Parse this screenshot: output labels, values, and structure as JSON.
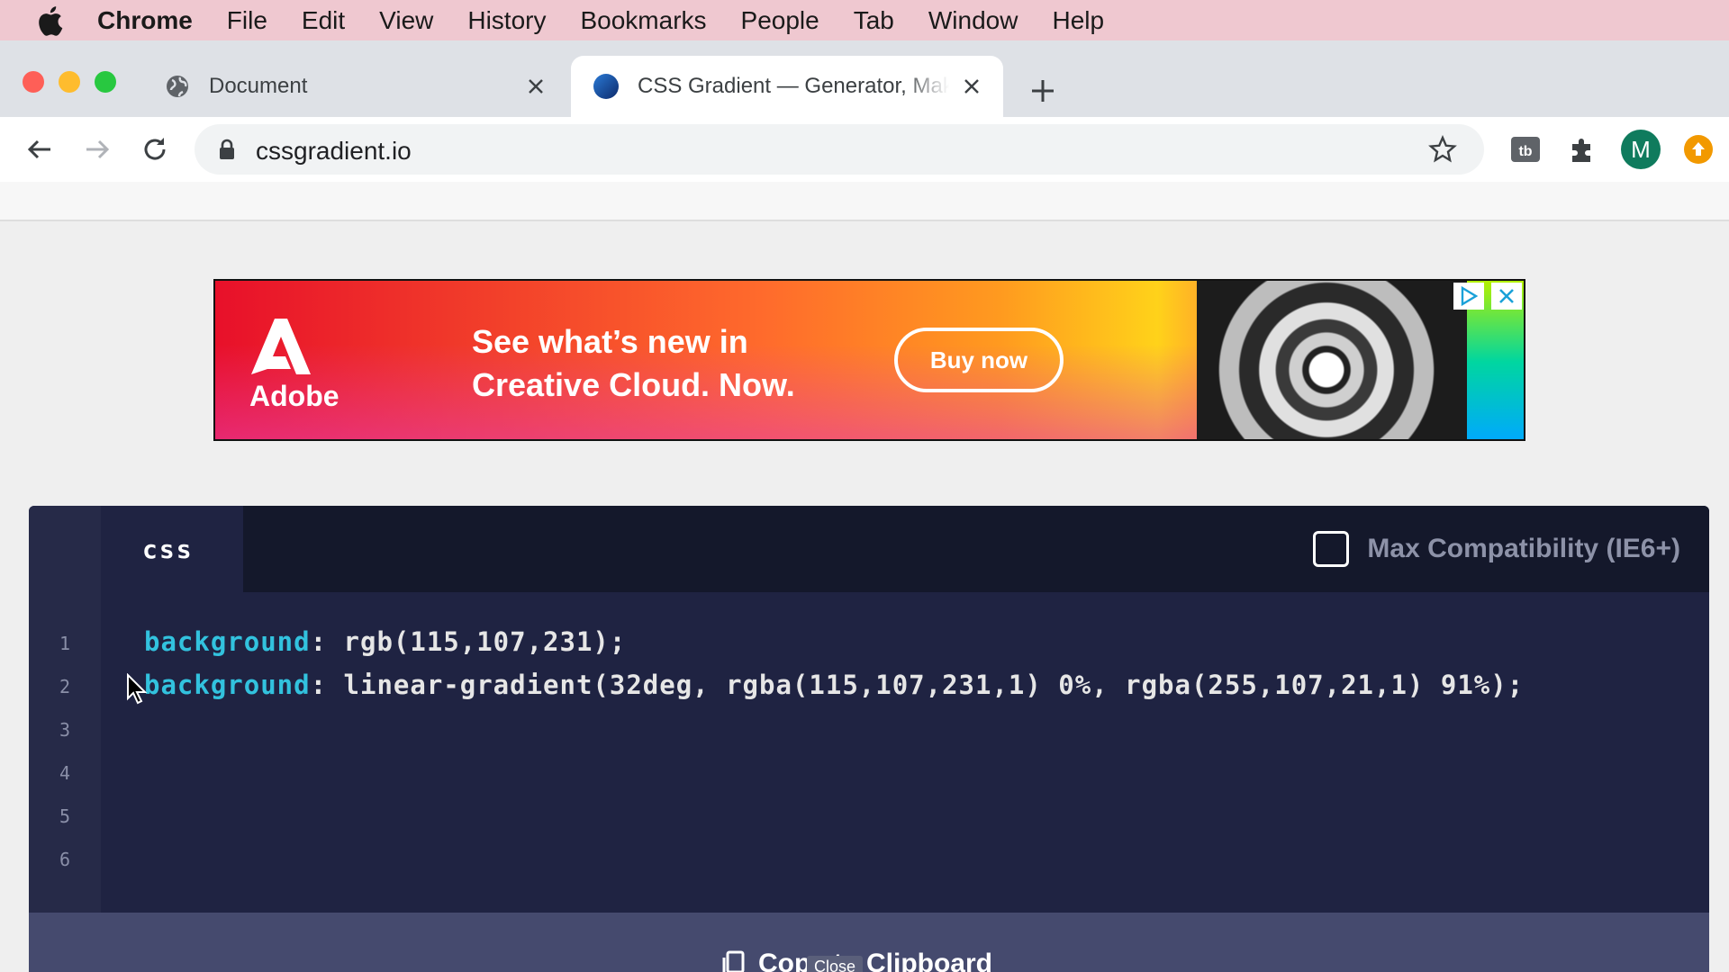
{
  "menubar": {
    "app": "Chrome",
    "items": [
      "File",
      "Edit",
      "View",
      "History",
      "Bookmarks",
      "People",
      "Tab",
      "Window",
      "Help"
    ]
  },
  "tabs": [
    {
      "title": "Document",
      "icon": "globe-icon",
      "active": false
    },
    {
      "title": "CSS Gradient — Generator, Maker, and Background",
      "icon": "cssgradient-favicon",
      "active": true
    }
  ],
  "toolbar": {
    "url": "cssgradient.io",
    "avatar_initial": "M"
  },
  "ad": {
    "brand": "Adobe",
    "headline": "See what’s new in Creative Cloud. Now.",
    "cta": "Buy now"
  },
  "code_panel": {
    "tab_label": "css",
    "compat_label": "Max Compatibility (IE6+)",
    "compat_checked": false,
    "line_numbers": [
      "1",
      "2",
      "3",
      "4",
      "5",
      "6"
    ],
    "lines": [
      {
        "prop": "background",
        "value": ": rgb(115,107,231);"
      },
      {
        "prop": "background",
        "value": ": linear-gradient(32deg, rgba(115,107,231,1) 0%, rgba(255,107,21,1) 91%);"
      }
    ],
    "copy_label": "Copy to Clipboard",
    "tooltip": "Close"
  },
  "colors": {
    "menubar_bg": "#efc8d0",
    "code_bg": "#1f2342",
    "code_prop": "#32c2de",
    "avatar_bg": "#0f7b5d"
  }
}
